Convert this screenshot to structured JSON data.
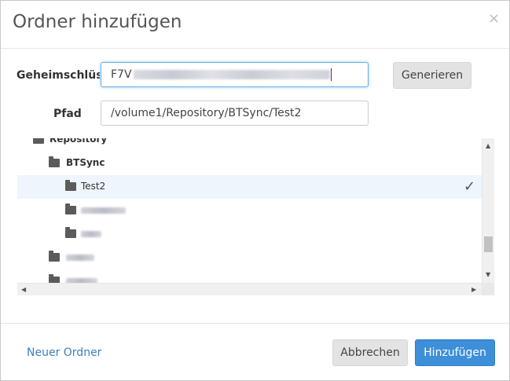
{
  "dialog": {
    "title": "Ordner hinzufügen",
    "close_glyph": "×"
  },
  "form": {
    "secret_label": "Geheimschlüssel",
    "secret_value_prefix": "F7V",
    "generate_button": "Generieren",
    "path_label": "Pfad",
    "path_value": "/volume1/Repository/BTSync/Test2"
  },
  "tree": {
    "items": [
      {
        "label": "Repository",
        "level": 0,
        "bold": true
      },
      {
        "label": "BTSync",
        "level": 1,
        "bold": true
      },
      {
        "label": "Test2",
        "level": 2,
        "selected": true
      },
      {
        "label": "",
        "level": 2,
        "redacted": true
      },
      {
        "label": "",
        "level": 2,
        "redacted": true
      },
      {
        "label": "",
        "level": 1,
        "redacted": true
      },
      {
        "label": "",
        "level": 1,
        "redacted": true
      }
    ],
    "check_glyph": "✓"
  },
  "footer": {
    "new_folder_link": "Neuer Ordner",
    "cancel_button": "Abbrechen",
    "add_button": "Hinzufügen"
  },
  "colors": {
    "primary": "#3c8fd8",
    "link": "#3c7fc0",
    "selected_row": "#eef5fc",
    "focus_border": "#66afe9"
  },
  "icons": {
    "folder": "folder-icon",
    "check": "check-icon",
    "close": "close-icon"
  }
}
